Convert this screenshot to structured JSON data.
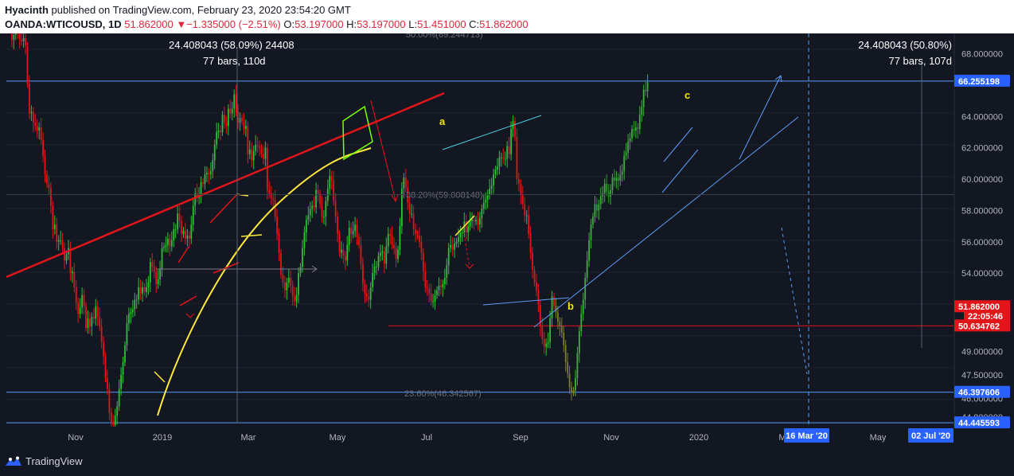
{
  "header": {
    "author": "Hyacinth",
    "published_text": "published on TradingView.com, February 23, 2020 23:54:20 GMT",
    "symbol": "OANDA:WTICOUSD, 1D",
    "last": "51.862000",
    "change": "−1.335000 (−2.51%)",
    "open_label": "O:",
    "open": "53.197000",
    "high_label": "H:",
    "high": "53.197000",
    "low_label": "L:",
    "low": "51.451000",
    "close_label": "C:",
    "close": "51.862000"
  },
  "footer": {
    "brand": "TradingView"
  },
  "colors": {
    "background": "#131722",
    "up": "#26a69a",
    "down": "#ef5350",
    "trend_red": "#e3151a",
    "curve_yellow": "#ffeb3b",
    "level_blue": "#5b9cf6",
    "projection_olive": "#7b7e2e",
    "projection_green": "#2f8f2f"
  },
  "chart_data": {
    "type": "candlestick",
    "symbol": "OANDA:WTICOUSD",
    "interval": "1D",
    "x_ticks": [
      "Nov",
      "2019",
      "Mar",
      "May",
      "Jul",
      "Sep",
      "Nov",
      "2020",
      "M",
      "May"
    ],
    "y_ticks": [
      "68.000000",
      "64.000000",
      "62.000000",
      "60.000000",
      "58.000000",
      "56.000000",
      "54.000000",
      "49.000000",
      "47.500000",
      "46.000000",
      "44.800000"
    ],
    "ylim": [
      44.2,
      69.3
    ],
    "price_tags": [
      {
        "label": "66.255198",
        "value": 66.255198,
        "kind": "level"
      },
      {
        "label": "51.862000",
        "value": 51.862,
        "kind": "last"
      },
      {
        "label": "22:05:46",
        "value": 51.25,
        "kind": "countdown"
      },
      {
        "label": "50.634762",
        "value": 50.634762,
        "kind": "level"
      },
      {
        "label": "46.397606",
        "value": 46.397606,
        "kind": "level"
      },
      {
        "label": "44.445593",
        "value": 44.445593,
        "kind": "level"
      }
    ],
    "date_tags": [
      {
        "label": "16 Mar '20",
        "x_index": 289
      },
      {
        "label": "02 Jul '20",
        "x_index": 363
      }
    ],
    "fib_levels": [
      {
        "label": "50.00%(69.244713)",
        "value": 69.244713
      },
      {
        "label": "38.20%(59.008148)",
        "value": 59.008148
      },
      {
        "label": "23.60%(46.342567)",
        "value": 46.342567
      }
    ],
    "measurements": [
      {
        "line1": "24.408043 (58.09%) 24408",
        "line2": "77 bars, 110d"
      },
      {
        "line1": "24.408043 (50.80%)",
        "line2": "77 bars, 107d"
      }
    ],
    "wave_labels": [
      "a",
      "b",
      "c"
    ],
    "candles": {
      "x_start": 0,
      "closes": [
        70.5,
        69.7,
        68.9,
        69.2,
        70.3,
        69.4,
        68.9,
        68.8,
        69.0,
        68.5,
        66.1,
        64.2,
        64.3,
        63.6,
        63.4,
        63.1,
        63.3,
        62.5,
        61.5,
        60.3,
        59.7,
        59.4,
        58.3,
        56.8,
        57.1,
        56.0,
        56.1,
        56.1,
        55.6,
        54.8,
        55.2,
        55.6,
        54.0,
        54.1,
        53.1,
        52.1,
        51.4,
        51.8,
        52.6,
        51.9,
        50.5,
        51.1,
        50.6,
        51.2,
        51.1,
        51.9,
        51.2,
        50.6,
        49.6,
        48.7,
        47.3,
        46.6,
        45.1,
        44.4,
        44.3,
        44.9,
        45.5,
        46.6,
        47.5,
        48.3,
        49.4,
        50.8,
        51.4,
        51.5,
        51.7,
        52.3,
        52.3,
        53.1,
        52.7,
        53.1,
        52.8,
        53.1,
        53.4,
        54.7,
        54.4,
        54.1,
        53.3,
        53.6,
        54.3,
        55.6,
        55.7,
        55.8,
        56.2,
        55.7,
        56.1,
        56.8,
        56.8,
        57.8,
        57.3,
        56.5,
        56.7,
        56.2,
        56.4,
        56.2,
        57.1,
        58.3,
        59.1,
        58.8,
        59.0,
        59.8,
        59.7,
        60.3,
        60.4,
        60.3,
        60.5,
        61.2,
        62.2,
        63.0,
        63.1,
        63.0,
        64.1,
        63.6,
        63.4,
        64.5,
        64.2,
        64.5,
        65.4,
        64.3,
        63.6,
        63.9,
        63.7,
        63.2,
        63.4,
        61.6,
        61.9,
        61.2,
        61.8,
        62.2,
        62.1,
        62.0,
        61.6,
        61.3,
        62.0,
        59.3,
        59.1,
        58.8,
        58.7,
        57.6,
        56.5,
        55.3,
        53.9,
        53.4,
        52.9,
        53.4,
        53.7,
        53.2,
        52.5,
        52.2,
        52.6,
        54.0,
        54.4,
        55.6,
        56.6,
        57.4,
        57.7,
        58.1,
        58.3,
        58.2,
        59.3,
        59.1,
        58.4,
        57.6,
        57.6,
        58.6,
        59.4,
        60.2,
        59.9,
        58.6,
        57.6,
        56.5,
        55.3,
        55.5,
        55.1,
        54.8,
        55.8,
        56.9,
        56.5,
        56.7,
        57.1,
        56.3,
        55.8,
        54.6,
        53.3,
        52.7,
        52.5,
        52.3,
        53.1,
        54.0,
        54.4,
        54.4,
        55.1,
        55.3,
        55.4,
        54.6,
        55.7,
        56.5,
        56.4,
        55.8,
        55.6,
        54.9,
        55.5,
        57.0,
        59.4,
        60.1,
        59.5,
        58.5,
        57.8,
        57.8,
        56.8,
        56.5,
        56.4,
        56.0,
        55.3,
        54.1,
        53.1,
        53.0,
        52.7,
        52.2,
        52.2,
        52.6,
        52.9,
        53.2,
        53.1,
        53.3,
        53.7,
        54.5,
        55.6,
        55.8,
        55.5,
        55.9,
        56.0,
        56.3,
        56.6,
        56.6,
        57.3,
        56.6,
        57.0,
        57.3,
        57.4,
        57.3,
        57.4,
        57.1,
        57.5,
        58.1,
        58.5,
        58.7,
        59.0,
        59.4,
        59.6,
        60.3,
        60.6,
        60.8,
        61.4,
        61.4,
        61.3,
        61.3,
        62.1,
        61.6,
        63.2,
        63.7,
        62.7,
        60.0,
        59.7,
        59.0,
        58.4,
        57.7,
        57.7,
        56.5,
        55.3,
        54.2,
        53.4,
        52.9,
        52.0,
        50.6,
        49.8,
        49.3,
        49.5,
        49.6,
        51.1,
        52.5,
        51.9
      ],
      "projection_closes": [
        51.5,
        50.9,
        50.6,
        50.2,
        49.4,
        48.3,
        47.6,
        46.7,
        46.4,
        46.5,
        47.3,
        48.9,
        50.3,
        51.4,
        52.3,
        53.7,
        54.8,
        56.1,
        57.1,
        57.6,
        58.4,
        58.0,
        58.4,
        58.9,
        59.1,
        59.7,
        59.2,
        58.9,
        59.3,
        60.1,
        59.9,
        60.1,
        59.9,
        60.3,
        60.5,
        61.5,
        61.7,
        62.4,
        62.6,
        63.2,
        63.1,
        63.3,
        63.2,
        64.1,
        64.6,
        65.7,
        65.6,
        66.2
      ]
    }
  }
}
